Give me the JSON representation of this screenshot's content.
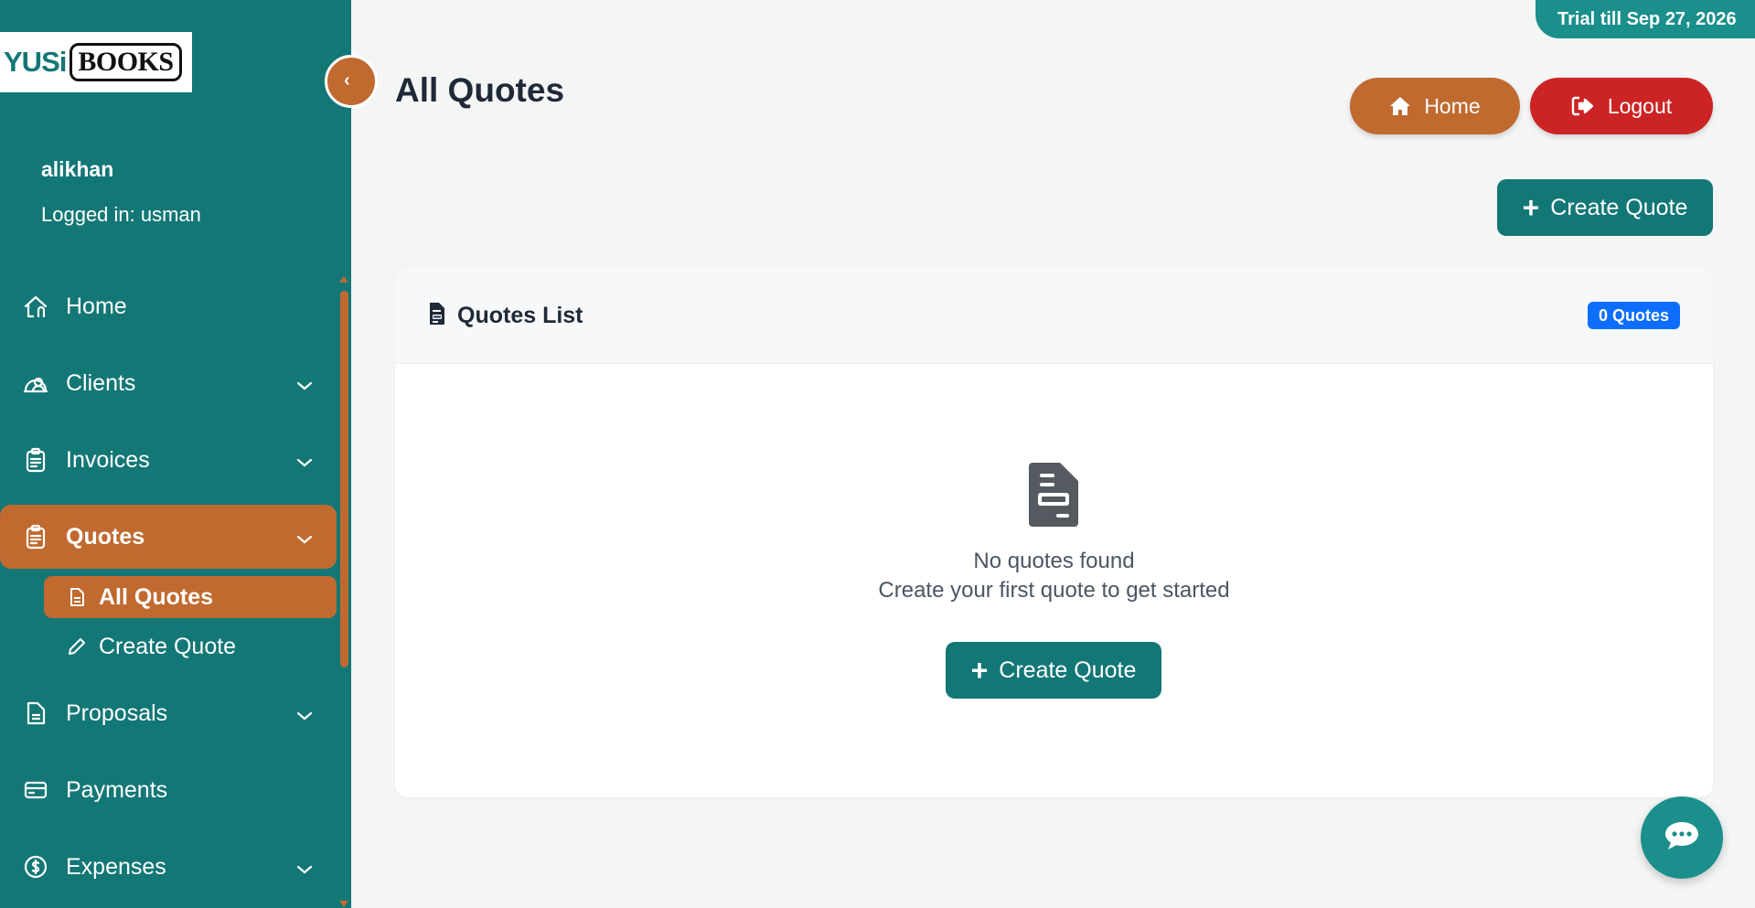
{
  "logo": {
    "part1": "YUSi",
    "part2": "BOOKS"
  },
  "user": {
    "name": "alikhan",
    "logged_in": "Logged in: usman"
  },
  "sidebar": {
    "items": [
      {
        "label": "Home",
        "icon": "home-icon"
      },
      {
        "label": "Clients",
        "icon": "clients-icon"
      },
      {
        "label": "Invoices",
        "icon": "clipboard-icon"
      },
      {
        "label": "Quotes",
        "icon": "clipboard-icon"
      },
      {
        "label": "Proposals",
        "icon": "document-icon"
      },
      {
        "label": "Payments",
        "icon": "credit-card-icon"
      },
      {
        "label": "Expenses",
        "icon": "dollar-circle-icon"
      }
    ],
    "sub_items": [
      {
        "label": "All Quotes",
        "icon": "document-icon"
      },
      {
        "label": "Create Quote",
        "icon": "pencil-icon"
      }
    ]
  },
  "header": {
    "trial": "Trial till Sep 27, 2026",
    "title": "All Quotes",
    "home_label": "Home",
    "logout_label": "Logout",
    "create_label": "Create Quote"
  },
  "card": {
    "title": "Quotes List",
    "badge": "0 Quotes",
    "empty_title": "No quotes found",
    "empty_subtitle": "Create your first quote to get started",
    "create_label": "Create Quote"
  },
  "colors": {
    "sidebar": "#137776",
    "accent": "#c06a30",
    "danger": "#cc2424",
    "badge": "#0d6efd"
  }
}
